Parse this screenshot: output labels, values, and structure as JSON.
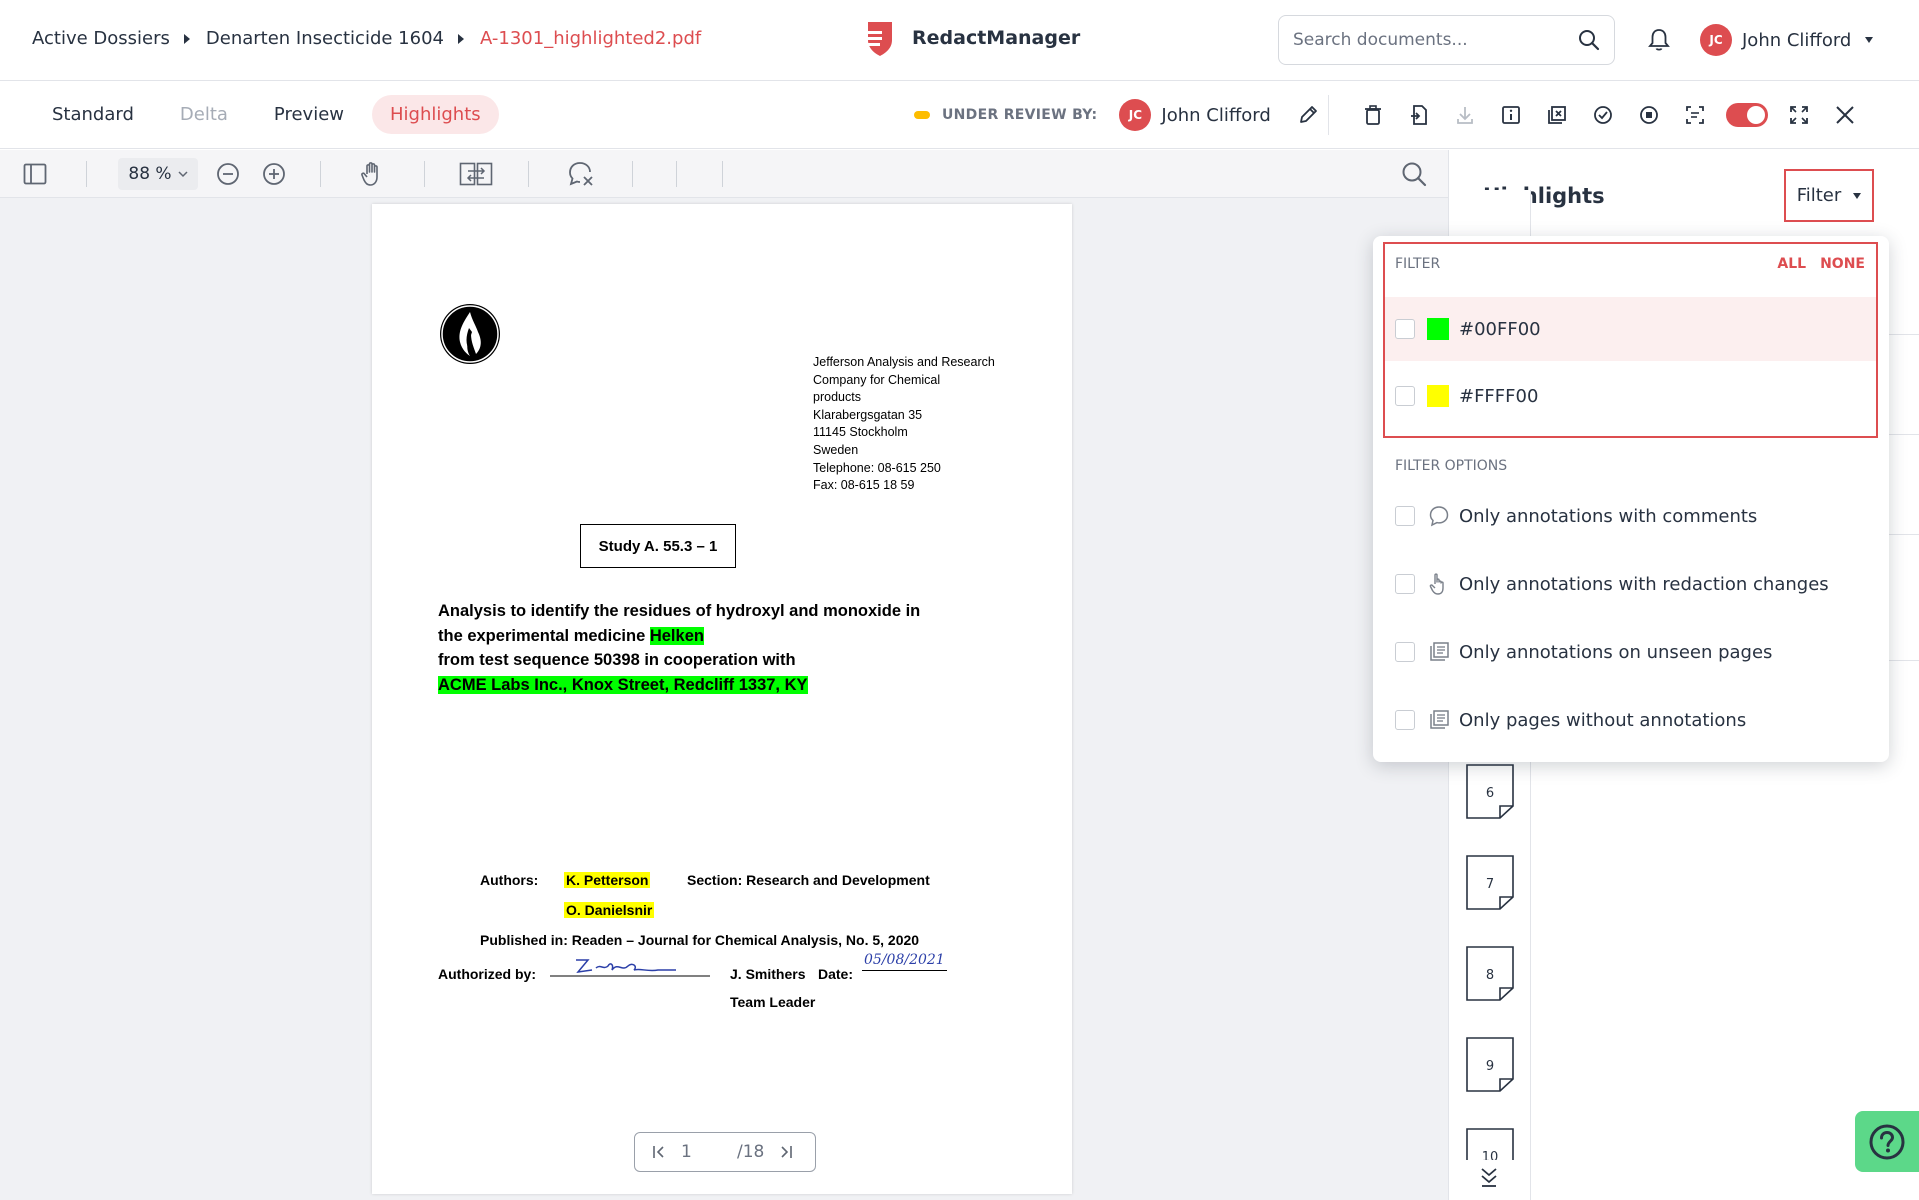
{
  "header": {
    "breadcrumb": [
      "Active Dossiers",
      "Denarten Insecticide 1604",
      "A-1301_highlighted2.pdf"
    ],
    "brand": "RedactManager",
    "search_placeholder": "Search documents...",
    "user": {
      "initials": "JC",
      "name": "John Clifford"
    }
  },
  "subbar": {
    "tabs": [
      {
        "label": "Standard",
        "state": "normal"
      },
      {
        "label": "Delta",
        "state": "disabled"
      },
      {
        "label": "Preview",
        "state": "normal"
      },
      {
        "label": "Highlights",
        "state": "active"
      }
    ],
    "status_label": "UNDER REVIEW BY:",
    "reviewer": {
      "initials": "JC",
      "name": "John Clifford"
    }
  },
  "viewer": {
    "zoom": "88 %",
    "page_current": "1",
    "page_total": "/18"
  },
  "document": {
    "address_lines": [
      "Jefferson Analysis and Research",
      "Company for Chemical",
      "products",
      "Klarabergsgatan 35",
      "11145 Stockholm",
      "Sweden",
      "Telephone: 08-615 250",
      "Fax: 08-615 18 59"
    ],
    "study": "Study A. 55.3 – 1",
    "analysis_line1": "Analysis to identify the residues of hydroxyl and monoxide in",
    "analysis_line2_prefix": "the experimental medicine",
    "analysis_line2_highlight": "Helken",
    "analysis_line3": "from test sequence 50398 in cooperation with",
    "analysis_line4_highlight": "ACME Labs Inc., Knox Street, Redcliff 1337, KY",
    "authors_label": "Authors:",
    "author1": "K. Petterson",
    "author2": "O. Danielsnir",
    "section": "Section: Research and Development",
    "published": "Published in: Readen – Journal for Chemical Analysis, No. 5, 2020",
    "authorized_label": "Authorized by:",
    "signer": "J. Smithers",
    "date_label": "Date:",
    "date_value": "05/08/2021",
    "role": "Team Leader"
  },
  "panel": {
    "title": "Highlights",
    "filter_label": "Filter",
    "thumb_pages": [
      "6",
      "7",
      "8",
      "9",
      "10"
    ]
  },
  "filter_dropdown": {
    "heading": "FILTER",
    "all": "ALL",
    "none": "NONE",
    "colors": [
      {
        "label": "#00FF00",
        "color": "#00ff00"
      },
      {
        "label": "#FFFF00",
        "color": "#ffff00"
      }
    ],
    "options_heading": "FILTER OPTIONS",
    "options": [
      {
        "label": "Only annotations with comments",
        "icon": "comment-icon"
      },
      {
        "label": "Only annotations with redaction changes",
        "icon": "hand-pointer-icon"
      },
      {
        "label": "Only annotations on unseen pages",
        "icon": "pages-icon"
      },
      {
        "label": "Only pages without annotations",
        "icon": "pages-icon"
      }
    ]
  },
  "colors": {
    "accent": "#dd4d50",
    "status": "#fdbd00",
    "help": "#5cd889"
  }
}
